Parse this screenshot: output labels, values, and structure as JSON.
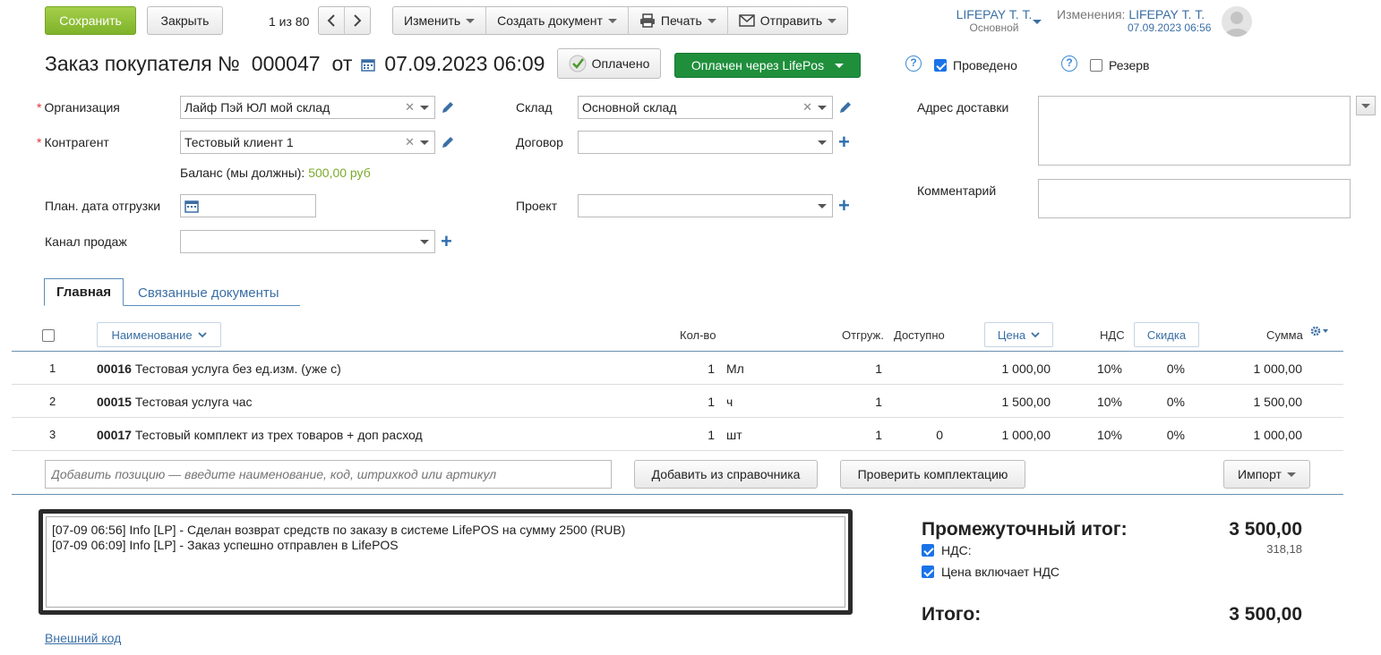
{
  "toolbar": {
    "save": "Сохранить",
    "close": "Закрыть",
    "pager": "1 из 80",
    "edit": "Изменить",
    "create_doc": "Создать документ",
    "print": "Печать",
    "send": "Отправить"
  },
  "user": {
    "name": "LIFEPAY Т. Т.",
    "role": "Основной",
    "changes_label": "Изменения:",
    "changes_user": "LIFEPAY Т. Т.",
    "changes_date": "07.09.2023 06:56"
  },
  "doc": {
    "title": "Заказ покупателя №",
    "number": "000047",
    "from": "от",
    "date": "07.09.2023 06:09",
    "paid_button": "Оплачено",
    "paid_via": "Оплачен через LifePos",
    "posted": "Проведено",
    "reserve": "Резерв"
  },
  "form": {
    "org_label": "Организация",
    "org_value": "Лайф Пэй ЮЛ мой склад",
    "contractor_label": "Контрагент",
    "contractor_value": "Тестовый клиент 1",
    "balance_label": "Баланс (мы должны):",
    "balance_value": "500,00 руб",
    "ship_date_label": "План. дата отгрузки",
    "channel_label": "Канал продаж",
    "warehouse_label": "Склад",
    "warehouse_value": "Основной склад",
    "contract_label": "Договор",
    "project_label": "Проект",
    "address_label": "Адрес доставки",
    "comment_label": "Комментарий"
  },
  "tabs": [
    "Главная",
    "Связанные документы"
  ],
  "table": {
    "headers": {
      "name": "Наименование",
      "qty": "Кол-во",
      "shipped": "Отгруж.",
      "available": "Доступно",
      "price": "Цена",
      "vat": "НДС",
      "discount": "Скидка",
      "sum": "Сумма"
    },
    "rows": [
      {
        "n": "1",
        "code": "00016",
        "name": "Тестовая услуга без ед.изм. (уже с)",
        "qty": "1",
        "unit": "Мл",
        "shipped": "1",
        "available": "",
        "price": "1 000,00",
        "vat": "10%",
        "discount": "0%",
        "sum": "1 000,00"
      },
      {
        "n": "2",
        "code": "00015",
        "name": "Тестовая услуга час",
        "qty": "1",
        "unit": "ч",
        "shipped": "1",
        "available": "",
        "price": "1 500,00",
        "vat": "10%",
        "discount": "0%",
        "sum": "1 500,00"
      },
      {
        "n": "3",
        "code": "00017",
        "name": "Тестовый комплект из трех товаров + доп расход",
        "qty": "1",
        "unit": "шт",
        "shipped": "1",
        "available": "0",
        "price": "1 000,00",
        "vat": "10%",
        "discount": "0%",
        "sum": "1 000,00"
      }
    ],
    "add_placeholder": "Добавить позицию — введите наименование, код, штрихкод или артикул",
    "add_from_catalog": "Добавить из справочника",
    "check_kit": "Проверить комплектацию",
    "import": "Импорт"
  },
  "log": [
    "[07-09 06:56] Info [LP] - Сделан возврат средств по заказу в системе LifePOS на сумму 2500 (RUB)",
    "[07-09 06:09] Info [LP] - Заказ успешно отправлен в LifePOS"
  ],
  "external_code": "Внешний код",
  "totals": {
    "subtotal_label": "Промежуточный итог:",
    "subtotal": "3 500,00",
    "vat_label": "НДС:",
    "vat_value": "318,18",
    "price_incl_vat": "Цена включает НДС",
    "total_label": "Итого:",
    "total": "3 500,00"
  },
  "colors": {
    "accent_blue": "#3b6fa5",
    "save_green": "#8cc13a",
    "paid_green": "#1f8f3c",
    "balance_green": "#7caa2b"
  }
}
